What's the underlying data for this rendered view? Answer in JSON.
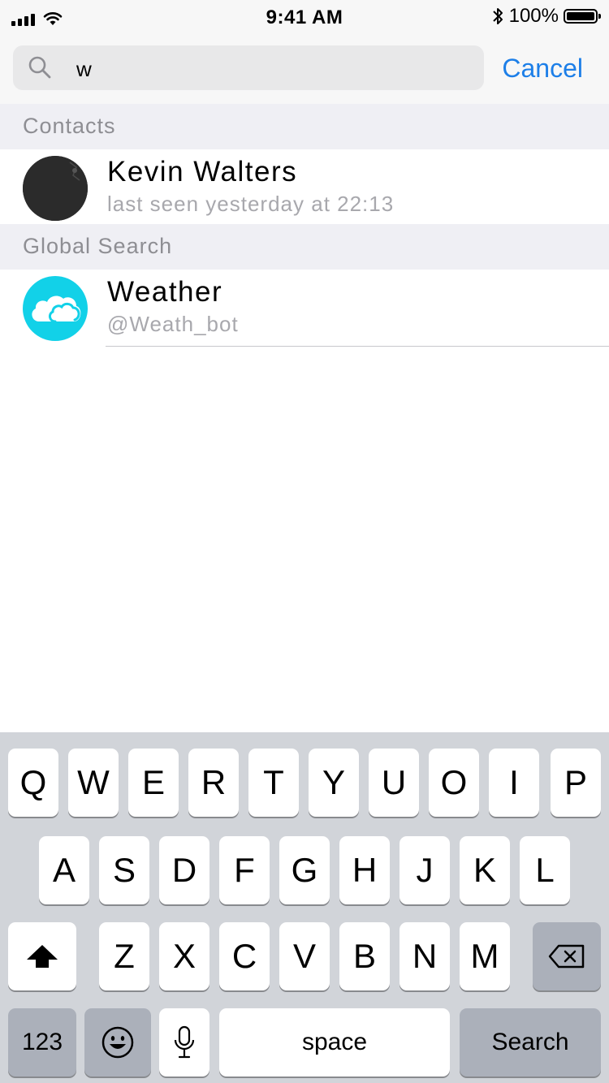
{
  "status": {
    "time": "9:41 AM",
    "battery": "100%",
    "battery_level": 1.0
  },
  "search": {
    "value": "w",
    "cancel_label": "Cancel"
  },
  "sections": [
    {
      "header": "Contacts",
      "rows": [
        {
          "title": "Kevin Walters",
          "subtitle": "last seen yesterday at 22:13",
          "avatar": "photo"
        }
      ]
    },
    {
      "header": "Global Search",
      "rows": [
        {
          "title": "Weather",
          "subtitle": "@Weath_bot",
          "avatar": "cloud-icon"
        }
      ]
    }
  ],
  "keyboard": {
    "row1": [
      "Q",
      "W",
      "E",
      "R",
      "T",
      "Y",
      "U",
      "O",
      "I",
      "P"
    ],
    "row2": [
      "A",
      "S",
      "D",
      "F",
      "G",
      "H",
      "J",
      "K",
      "L"
    ],
    "row3": [
      "Z",
      "X",
      "C",
      "V",
      "B",
      "N",
      "M"
    ],
    "numbers_label": "123",
    "space_label": "space",
    "search_label": "Search",
    "icons": {
      "shift": "shift-arrow-icon",
      "delete": "backspace-icon",
      "emoji": "emoji-icon",
      "mic": "microphone-icon"
    }
  },
  "colors": {
    "accent": "#1d7fe8",
    "section_bg": "#efeff4",
    "weather_avatar": "#12d1e8",
    "keyboard_bg": "#d1d4d9"
  }
}
